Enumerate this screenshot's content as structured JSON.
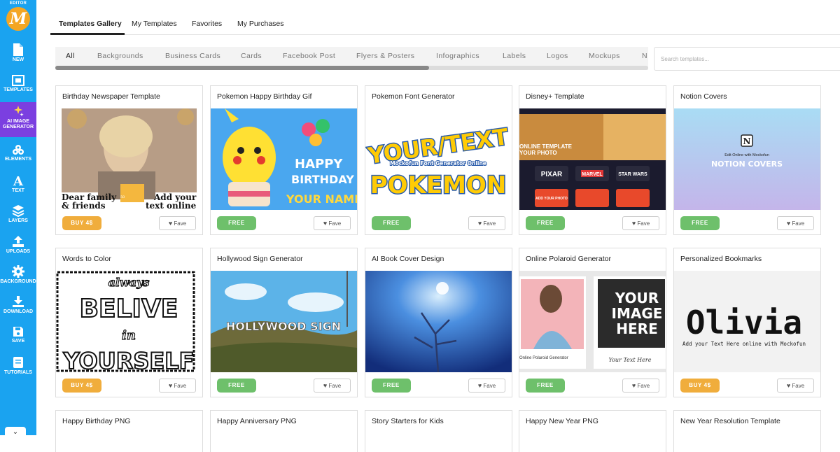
{
  "sidebar": {
    "editor_label": "EDITOR",
    "logo_letter": "M",
    "items": [
      {
        "label": "NEW",
        "icon": "new-file-icon"
      },
      {
        "label": "TEMPLATES",
        "icon": "templates-icon"
      },
      {
        "label": "AI IMAGE GENERATOR",
        "icon": "sparkles-icon"
      },
      {
        "label": "ELEMENTS",
        "icon": "elements-icon"
      },
      {
        "label": "TEXT",
        "icon": "text-icon"
      },
      {
        "label": "LAYERS",
        "icon": "layers-icon"
      },
      {
        "label": "UPLOADS",
        "icon": "upload-icon"
      },
      {
        "label": "BACKGROUND",
        "icon": "gear-icon"
      },
      {
        "label": "DOWNLOAD",
        "icon": "download-icon"
      },
      {
        "label": "SAVE",
        "icon": "save-icon"
      },
      {
        "label": "TUTORIALS",
        "icon": "tutorials-icon"
      }
    ],
    "collapse": "⌄"
  },
  "tabs": [
    "Templates Gallery",
    "My Templates",
    "Favorites",
    "My Purchases"
  ],
  "categories": [
    "All",
    "Backgrounds",
    "Business Cards",
    "Cards",
    "Facebook Post",
    "Flyers & Posters",
    "Infographics",
    "Labels",
    "Logos",
    "Mockups",
    "N"
  ],
  "search": {
    "placeholder": "Search templates..."
  },
  "fave_label": "Fave",
  "cards": [
    {
      "title": "Birthday Newspaper Template",
      "price": "BUY 4$",
      "type": "buy",
      "thumb_text": [
        "Dear family & friends",
        "50",
        "Add your text online"
      ]
    },
    {
      "title": "Pokemon Happy Birthday Gif",
      "price": "FREE",
      "type": "free",
      "thumb_text": [
        "HAPPY",
        "BIRTHDAY",
        "YOUR NAME"
      ]
    },
    {
      "title": "Pokemon Font Generator",
      "price": "FREE",
      "type": "free",
      "thumb_text": [
        "YOUR/TEXT",
        "Mockofun Font Generator Online",
        "POKEMON"
      ]
    },
    {
      "title": "Disney+ Template",
      "price": "FREE",
      "type": "free",
      "thumb_text": [
        "ONLINE TEMPLATE",
        "YOUR PHOTO",
        "PIXAR",
        "MARVEL",
        "STAR WARS",
        "ADD YOUR PHOTO"
      ]
    },
    {
      "title": "Notion Covers",
      "price": "FREE",
      "type": "free",
      "thumb_text": [
        "Edit Online with Mockofun",
        "NOTION COVERS"
      ]
    },
    {
      "title": "Words to Color",
      "price": "BUY 4$",
      "type": "buy",
      "thumb_text": [
        "always",
        "BELIVE",
        "in",
        "YOURSELF"
      ]
    },
    {
      "title": "Hollywood Sign Generator",
      "price": "FREE",
      "type": "free",
      "thumb_text": [
        "HOLLYWOOD SIGN"
      ]
    },
    {
      "title": "AI Book Cover Design",
      "price": "FREE",
      "type": "free",
      "thumb_text": []
    },
    {
      "title": "Online Polaroid Generator",
      "price": "FREE",
      "type": "free",
      "thumb_text": [
        "YOUR",
        "IMAGE",
        "HERE",
        "Online Polaroid Generator",
        "Your Text Here"
      ]
    },
    {
      "title": "Personalized Bookmarks",
      "price": "BUY 4$",
      "type": "buy",
      "thumb_text": [
        "Olivia",
        "Add your Text Here online with Mockofun"
      ]
    },
    {
      "title": "Happy Birthday PNG"
    },
    {
      "title": "Happy Anniversary PNG"
    },
    {
      "title": "Story Starters for Kids"
    },
    {
      "title": "Happy New Year PNG"
    },
    {
      "title": "New Year Resolution Template"
    }
  ],
  "colors": {
    "sidebar": "#1aa3f0",
    "buy": "#f0ad3c",
    "free": "#6ec06b",
    "ai": "#7b3fe0"
  }
}
